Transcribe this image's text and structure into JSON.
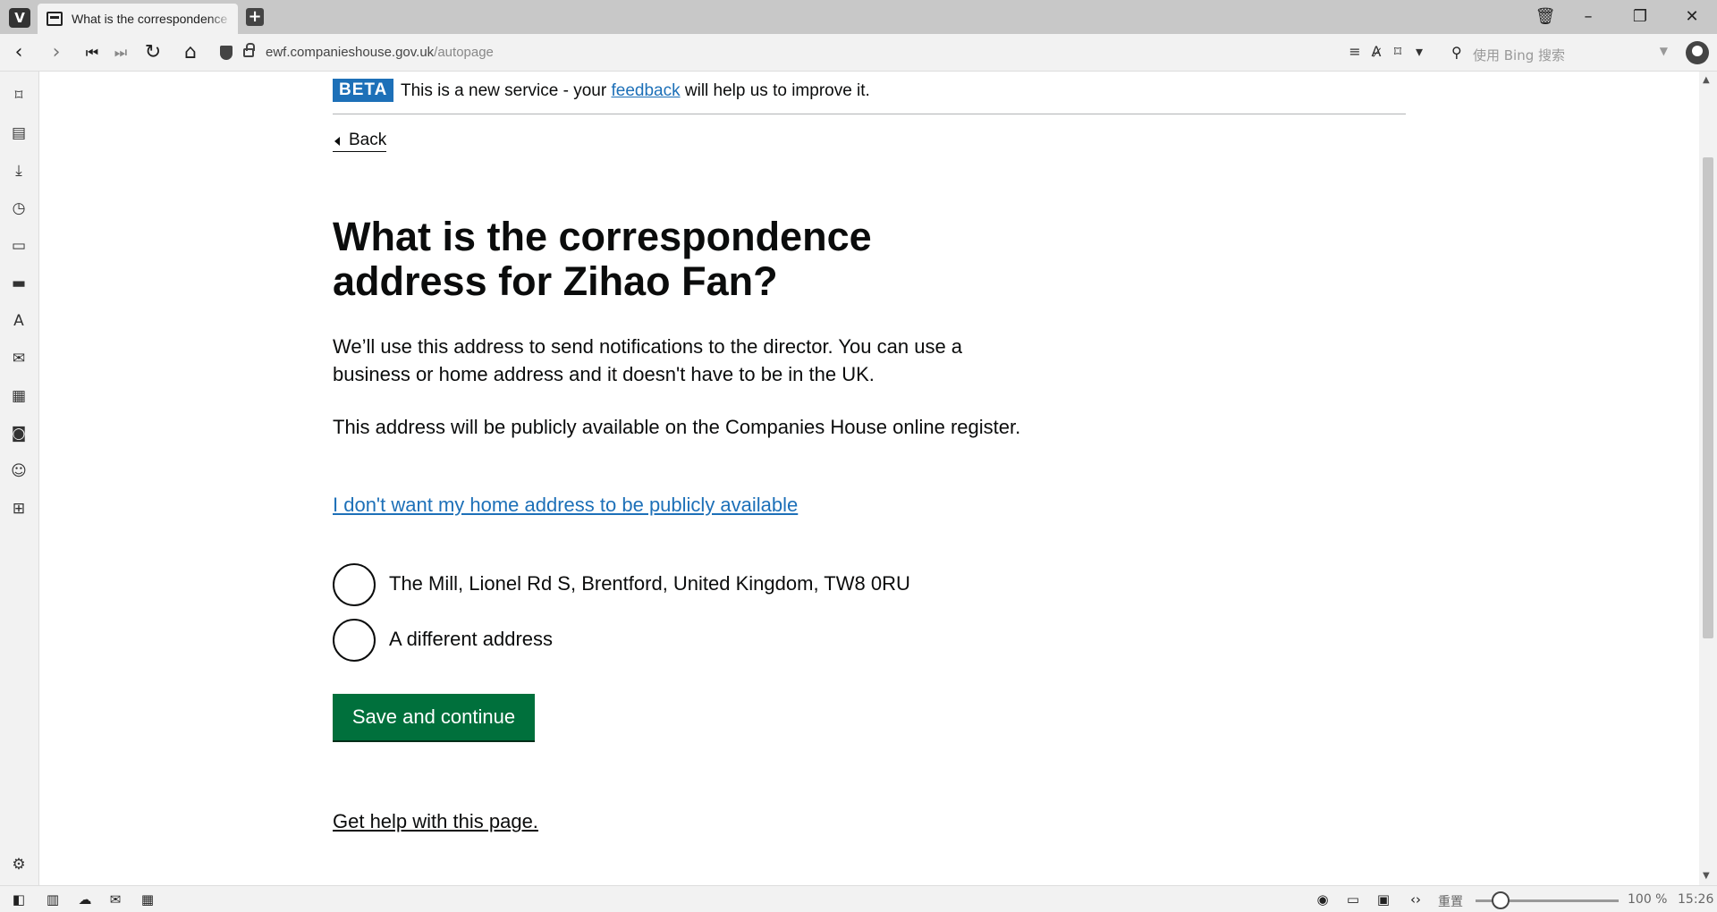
{
  "browser": {
    "tab_title": "What is the correspondence",
    "url_domain": "ewf.companieshouse.gov.uk",
    "url_path": "/autopage",
    "search_placeholder": "使用 Bing 搜索",
    "zoom_label": "100 %",
    "clock": "15:26",
    "reset_label": "重置"
  },
  "banner": {
    "tag": "BETA",
    "text_before": "This is a new service - your ",
    "link": "feedback",
    "text_after": " will help us to improve it."
  },
  "page": {
    "back_label": "Back",
    "heading": "What is the correspondence address for Zihao Fan?",
    "paragraph_1": "We’ll use this address to send notifications to the director. You can use a business or home address and it doesn't have to be in the UK.",
    "paragraph_2": "This address will be publicly available on the Companies House online register.",
    "privacy_link": "I don't want my home address to be publicly available",
    "options": [
      {
        "label": "The Mill, Lionel Rd S, Brentford, United Kingdom, TW8 0RU"
      },
      {
        "label": "A different address"
      }
    ],
    "save_button": "Save and continue",
    "help_link": "Get help with this page."
  }
}
